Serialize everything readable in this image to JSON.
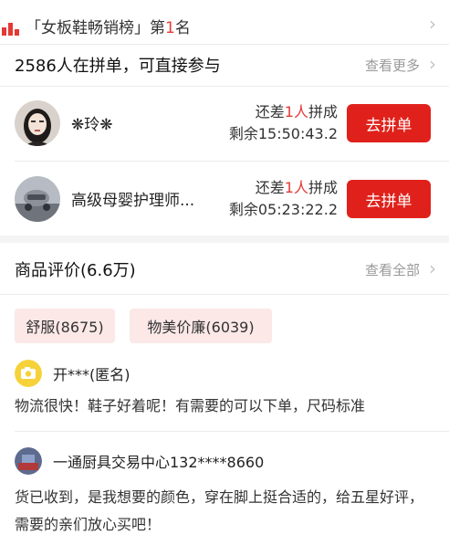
{
  "rank": {
    "prefix": "「女板鞋畅销榜」第",
    "number": "1",
    "suffix": "名"
  },
  "group_buy": {
    "title": "2586人在拼单，可直接参与",
    "more_label": "查看更多",
    "rows": [
      {
        "name": "❋玲❋",
        "need_prefix": "还差",
        "need_count": "1人",
        "need_suffix": "拼成",
        "remaining_label": "剩余",
        "remaining_time": "15:50:43.2",
        "button_label": "去拼单"
      },
      {
        "name": "高级母婴护理师...",
        "need_prefix": "还差",
        "need_count": "1人",
        "need_suffix": "拼成",
        "remaining_label": "剩余",
        "remaining_time": "05:23:22.2",
        "button_label": "去拼单"
      }
    ]
  },
  "reviews": {
    "title": "商品评价(6.6万)",
    "all_label": "查看全部",
    "tags": [
      "舒服(8675)",
      "物美价廉(6039)"
    ],
    "items": [
      {
        "user": "开***(匿名)",
        "text": "物流很快！鞋子好着呢！有需要的可以下单，尺码标准"
      },
      {
        "user": "一通厨具交易中心132****8660",
        "text": "货已收到，是我想要的颜色，穿在脚上挺合适的，给五星好评，需要的亲们放心买吧！"
      }
    ]
  },
  "colors": {
    "accent": "#e0211b",
    "tag_bg": "#fbe8e7"
  }
}
